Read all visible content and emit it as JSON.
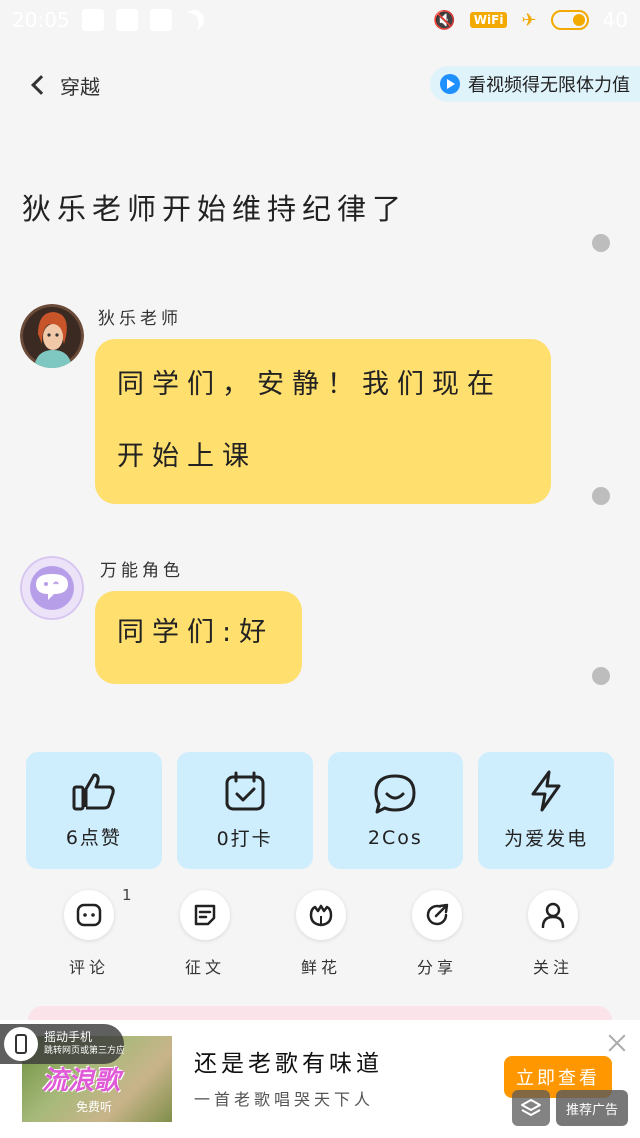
{
  "status_bar": {
    "time": "20:05",
    "wifi_label": "WiFi",
    "battery": "40"
  },
  "nav": {
    "back_label": "穿越",
    "video_reward_label": "看视频得无限体力值"
  },
  "story": {
    "title": "狄乐老师开始维持纪律了"
  },
  "messages": [
    {
      "speaker": "狄乐老师",
      "text": "同学们，安静！我们现在开始上课"
    },
    {
      "speaker": "万能角色",
      "text": "同学们:好"
    }
  ],
  "actions": [
    {
      "label": "6点赞",
      "icon": "thumbs-up-icon"
    },
    {
      "label": "0打卡",
      "icon": "calendar-check-icon"
    },
    {
      "label": "2Cos",
      "icon": "chat-smile-icon"
    },
    {
      "label": "为爱发电",
      "icon": "lightning-icon"
    }
  ],
  "small_actions": [
    {
      "label": "评论",
      "icon": "comment-icon",
      "count": "1"
    },
    {
      "label": "征文",
      "icon": "essay-icon"
    },
    {
      "label": "鲜花",
      "icon": "flower-icon"
    },
    {
      "label": "分享",
      "icon": "share-icon"
    },
    {
      "label": "关注",
      "icon": "follow-user-icon"
    }
  ],
  "ad": {
    "shake_title": "摇动手机",
    "shake_sub": "跳转网页或第三方应用",
    "image_title": "流浪歌",
    "image_sub": "免费听",
    "title": "还是老歌有味道",
    "desc": "一首老歌唱哭天下人",
    "cta": "立即查看",
    "tag": "推荐广告"
  },
  "colors": {
    "bubble": "#ffdf6e",
    "card": "#cfeefd",
    "accent": "#ff9800",
    "status_accent": "#f2a900"
  }
}
